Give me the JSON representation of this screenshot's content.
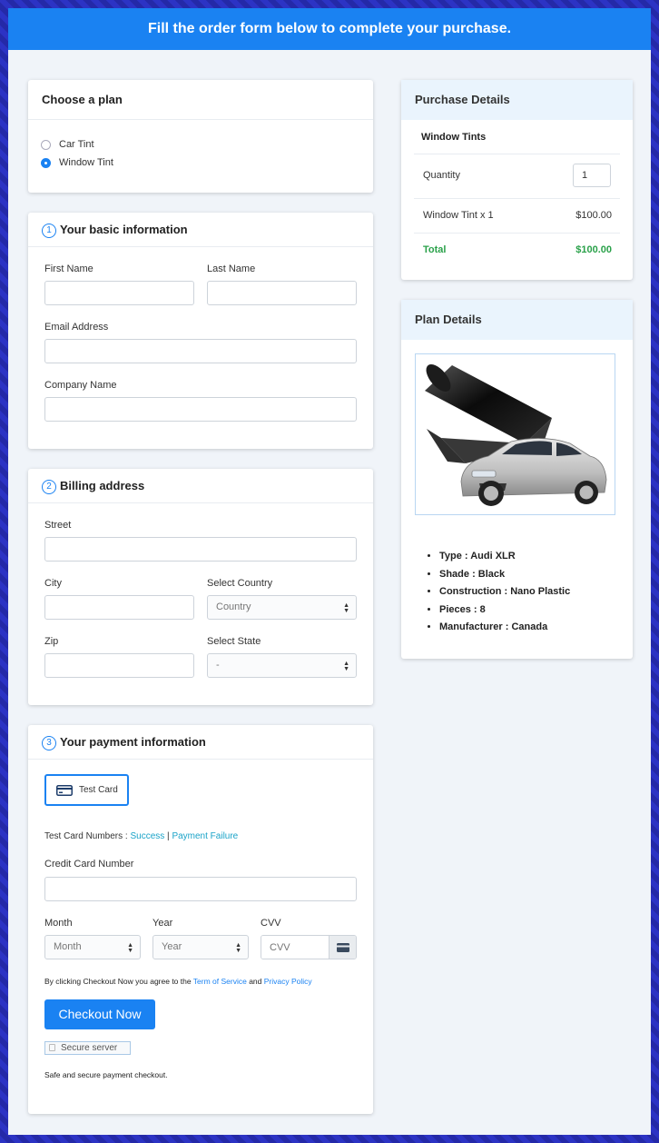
{
  "banner": {
    "title": "Fill the order form below to complete your purchase."
  },
  "plan": {
    "heading": "Choose a plan",
    "options": [
      {
        "label": "Car Tint",
        "selected": false
      },
      {
        "label": "Window Tint",
        "selected": true
      }
    ]
  },
  "basic": {
    "step": "1",
    "heading": "Your basic information",
    "first_name_label": "First Name",
    "last_name_label": "Last Name",
    "email_label": "Email Address",
    "company_label": "Company Name"
  },
  "billing": {
    "step": "2",
    "heading": "Billing address",
    "street_label": "Street",
    "city_label": "City",
    "country_label": "Select Country",
    "country_value": "Country",
    "zip_label": "Zip",
    "state_label": "Select State",
    "state_value": "-"
  },
  "payment": {
    "step": "3",
    "heading": "Your payment information",
    "card_button": "Test Card",
    "test_numbers_prefix": "Test Card Numbers : ",
    "success_link": "Success",
    "separator": " | ",
    "failure_link": "Payment Failure",
    "cc_label": "Credit Card Number",
    "month_label": "Month",
    "month_value": "Month",
    "year_label": "Year",
    "year_value": "Year",
    "cvv_label": "CVV",
    "cvv_placeholder": "CVV",
    "terms_prefix": "By clicking Checkout Now you agree to the ",
    "terms_link": "Term of Service",
    "terms_and": " and ",
    "privacy_link": "Privacy Policy",
    "checkout_button": "Checkout Now",
    "secure_badge": "Secure server",
    "safe_text": "Safe and secure payment checkout."
  },
  "purchase": {
    "heading": "Purchase Details",
    "product": "Window Tints",
    "quantity_label": "Quantity",
    "quantity_value": "1",
    "line_item": "Window Tint x 1",
    "line_price": "$100.00",
    "total_label": "Total",
    "total_value": "$100.00"
  },
  "plan_details": {
    "heading": "Plan Details",
    "items": [
      "Type : Audi XLR",
      "Shade : Black",
      "Construction : Nano Plastic",
      "Pieces : 8",
      "Manufacturer : Canada"
    ]
  },
  "colors": {
    "accent": "#1a82f2",
    "total_green": "#2aa14a",
    "link_teal": "#1aa3c8"
  }
}
